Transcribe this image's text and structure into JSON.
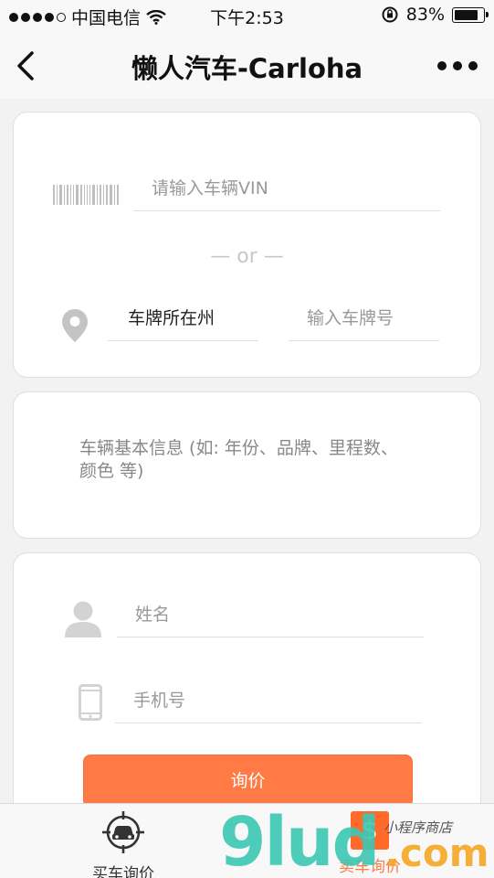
{
  "status_bar": {
    "carrier": "中国电信",
    "time": "下午2:53",
    "battery": "83%",
    "battery_level": 0.83
  },
  "nav": {
    "title": "懒人汽车-Carloha"
  },
  "vehicle_card": {
    "vin_placeholder": "请输入车辆VIN",
    "divider": "— or —",
    "plate_region": "车牌所在州",
    "plate_placeholder": "输入车牌号"
  },
  "info_card": {
    "placeholder": "车辆基本信息 (如: 年份、品牌、里程数、颜色 等)"
  },
  "contact_card": {
    "name_placeholder": "姓名",
    "phone_placeholder": "手机号",
    "submit_label": "询价"
  },
  "tabbar": {
    "tabs": [
      {
        "label": "买车询价",
        "icon": "car-target-icon"
      },
      {
        "label": "卖车询价",
        "icon": "dollar-icon"
      }
    ]
  },
  "watermark": {
    "big": "9lud",
    "com": ".com",
    "small": "小程序商店"
  },
  "colors": {
    "accent": "#ff7a45",
    "watermark_teal": "#3cc8b4",
    "watermark_orange": "#f5a623"
  }
}
